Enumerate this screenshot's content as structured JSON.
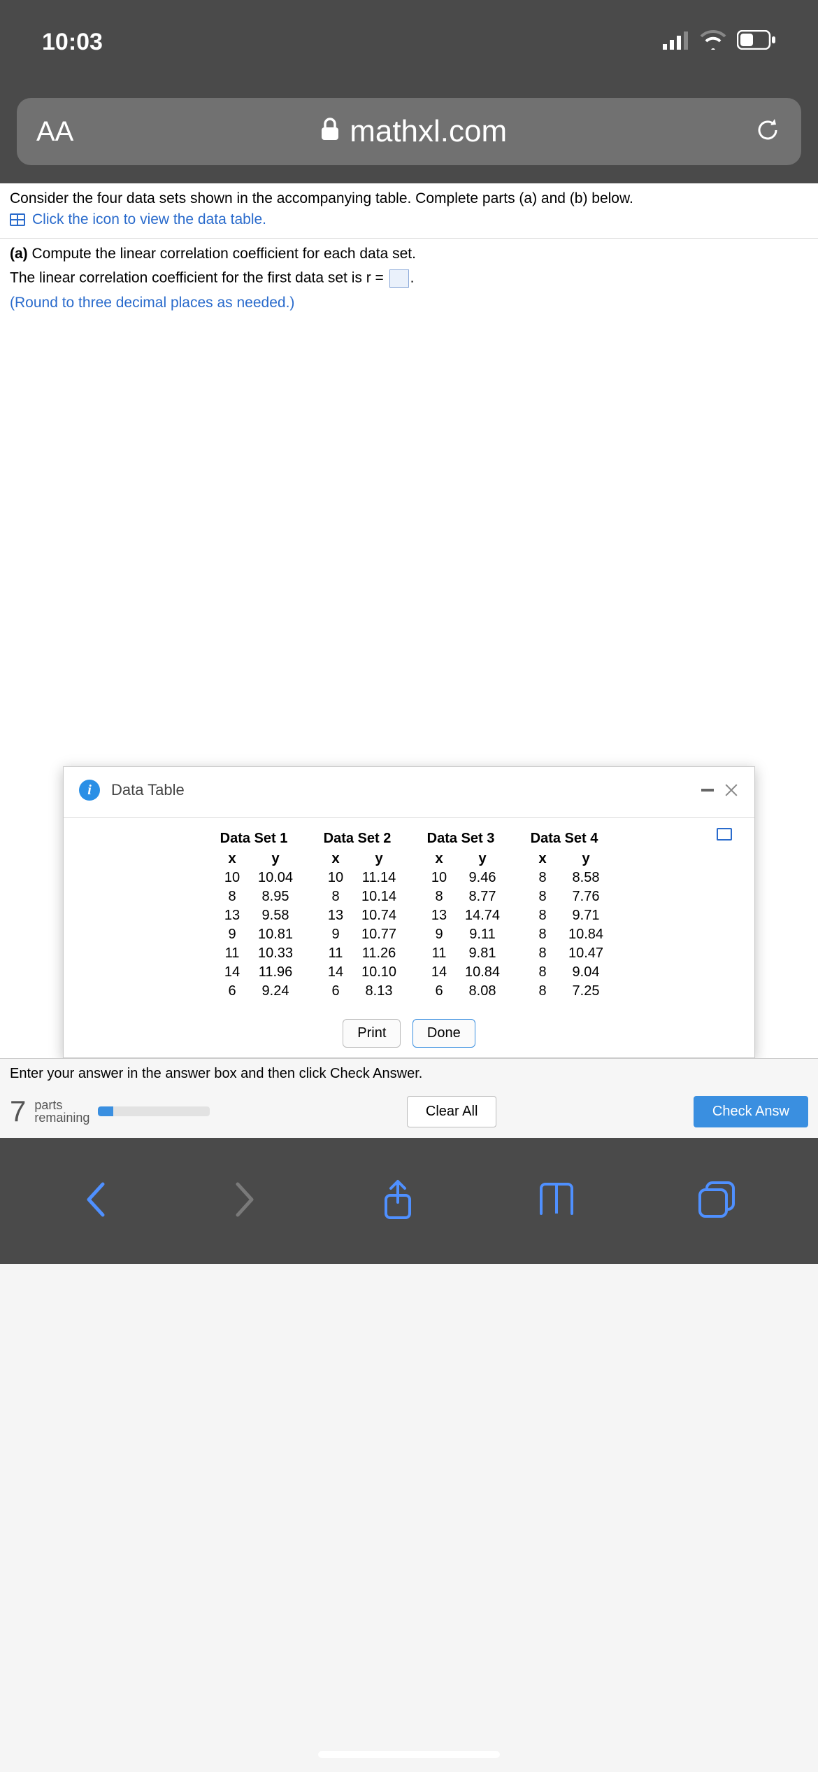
{
  "status": {
    "time": "10:03"
  },
  "browser": {
    "aa": "AA",
    "url": "mathxl.com"
  },
  "question": {
    "intro": "Consider the four data sets shown in the accompanying table. Complete parts (a) and (b) below.",
    "link": "Click the icon to view the data table.",
    "part_a_label": "(a)",
    "part_a_text": " Compute the linear correlation coefficient for each data set.",
    "answer_prefix": "The linear correlation coefficient for the first data set is r = ",
    "answer_suffix": ".",
    "hint": "(Round to three decimal places as needed.)"
  },
  "modal": {
    "title": "Data Table",
    "print": "Print",
    "done": "Done",
    "sets": [
      {
        "title": "Data Set 1",
        "hx": "x",
        "hy": "y",
        "rows": [
          [
            "10",
            "10.04"
          ],
          [
            "8",
            "8.95"
          ],
          [
            "13",
            "9.58"
          ],
          [
            "9",
            "10.81"
          ],
          [
            "11",
            "10.33"
          ],
          [
            "14",
            "11.96"
          ],
          [
            "6",
            "9.24"
          ]
        ]
      },
      {
        "title": "Data Set 2",
        "hx": "x",
        "hy": "y",
        "rows": [
          [
            "10",
            "11.14"
          ],
          [
            "8",
            "10.14"
          ],
          [
            "13",
            "10.74"
          ],
          [
            "9",
            "10.77"
          ],
          [
            "11",
            "11.26"
          ],
          [
            "14",
            "10.10"
          ],
          [
            "6",
            "8.13"
          ]
        ]
      },
      {
        "title": "Data Set 3",
        "hx": "x",
        "hy": "y",
        "rows": [
          [
            "10",
            "9.46"
          ],
          [
            "8",
            "8.77"
          ],
          [
            "13",
            "14.74"
          ],
          [
            "9",
            "9.11"
          ],
          [
            "11",
            "9.81"
          ],
          [
            "14",
            "10.84"
          ],
          [
            "6",
            "8.08"
          ]
        ]
      },
      {
        "title": "Data Set 4",
        "hx": "x",
        "hy": "y",
        "rows": [
          [
            "8",
            "8.58"
          ],
          [
            "8",
            "7.76"
          ],
          [
            "8",
            "9.71"
          ],
          [
            "8",
            "10.84"
          ],
          [
            "8",
            "10.47"
          ],
          [
            "8",
            "9.04"
          ],
          [
            "8",
            "7.25"
          ]
        ]
      }
    ]
  },
  "footer": {
    "prompt": "Enter your answer in the answer box and then click Check Answer.",
    "parts_num": "7",
    "parts_top": "parts",
    "parts_bot": "remaining",
    "clear": "Clear All",
    "check": "Check Answ"
  }
}
